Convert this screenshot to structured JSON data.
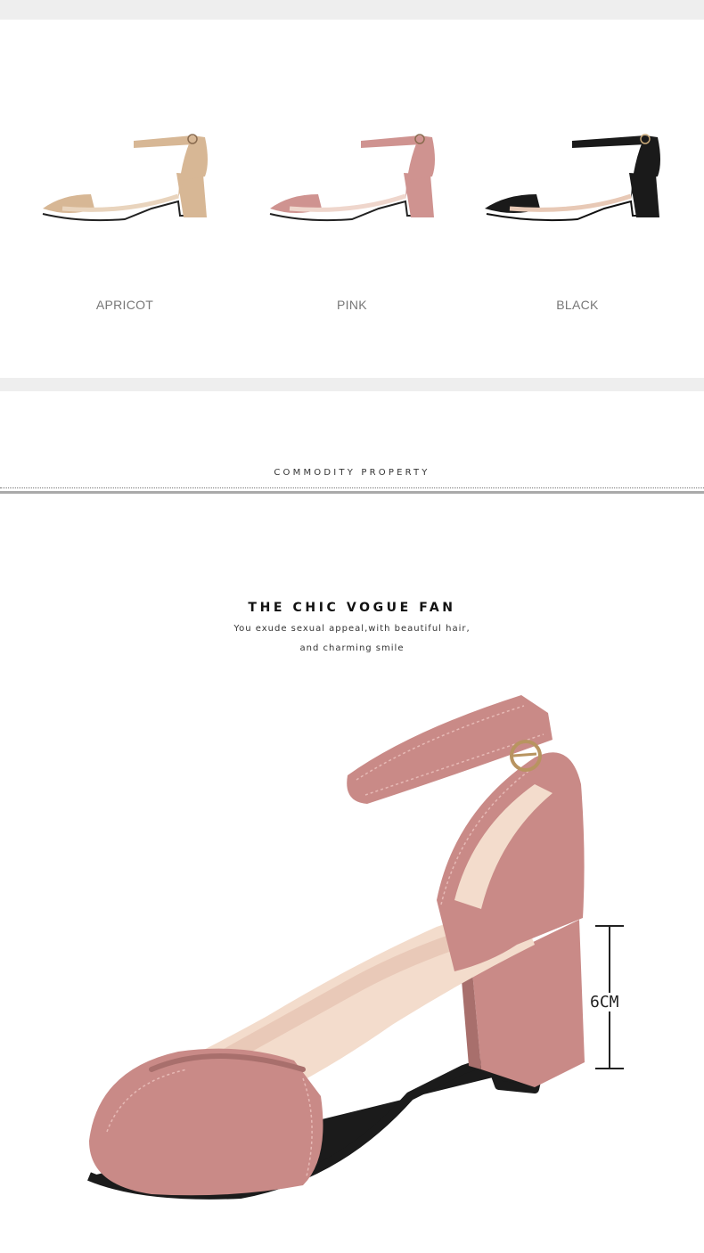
{
  "colors": [
    {
      "label": "APRICOT",
      "hex": "#d7b795",
      "dark": "#b8967a",
      "icon": "sandal-apricot-icon"
    },
    {
      "label": "PINK",
      "hex": "#cf9390",
      "dark": "#b57774",
      "icon": "sandal-pink-icon"
    },
    {
      "label": "BLACK",
      "hex": "#1a1a1a",
      "dark": "#000000",
      "icon": "sandal-black-icon"
    }
  ],
  "section": {
    "title": "COMMODITY PROPERTY"
  },
  "headline": "THE CHIC VOGUE FAN",
  "tagline": {
    "line1": "You exude sexual appeal,with beautiful hair,",
    "line2": "and charming smile"
  },
  "heel": {
    "label": "6CM"
  },
  "hero": {
    "icon": "sandal-pink-hero-icon",
    "suede": "#c98a87",
    "suede_dark": "#a86f6c",
    "lining": "#f3dccc",
    "sole": "#1b1b1b"
  }
}
